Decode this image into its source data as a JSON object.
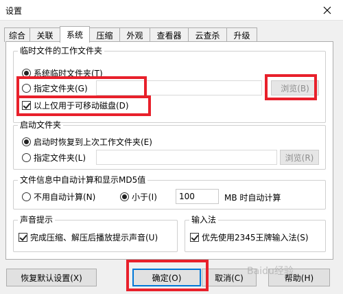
{
  "window": {
    "title": "设置"
  },
  "tabs": [
    {
      "label": "综合"
    },
    {
      "label": "关联"
    },
    {
      "label": "系统",
      "active": true
    },
    {
      "label": "压缩"
    },
    {
      "label": "外观"
    },
    {
      "label": "查看器"
    },
    {
      "label": "云查杀"
    },
    {
      "label": "升级"
    }
  ],
  "temp_folder": {
    "title": "临时文件的工作文件夹",
    "opt_system": "系统临时文件夹(T)",
    "opt_specify": "指定文件夹(G)",
    "path_value": "",
    "browse": "浏览(B)",
    "removable_only": "以上仅用于可移动磁盘(D)"
  },
  "startup_folder": {
    "title": "启动文件夹",
    "opt_restore": "启动时恢复到上次工作文件夹(E)",
    "opt_specify": "指定文件夹(L)",
    "path_value": "",
    "browse": "浏览(R)"
  },
  "md5": {
    "title": "文件信息中自动计算和显示MD5值",
    "opt_none": "不用自动计算(N)",
    "opt_less": "小于(I)",
    "size_value": "100",
    "unit_text": "MB 时自动计算"
  },
  "sound": {
    "title": "声音提示",
    "play_sound": "完成压缩、解压后播放提示声音(U)"
  },
  "ime": {
    "title": "输入法",
    "prefer_2345": "优先使用2345王牌输入法(S)"
  },
  "footer": {
    "restore": "恢复默认设置(X)",
    "ok": "确定(O)",
    "cancel": "取消(C)",
    "help": "帮助(H)"
  },
  "watermark": "Baidu经验",
  "colors": {
    "highlight": "#e8202b",
    "focus": "#0078d7"
  }
}
